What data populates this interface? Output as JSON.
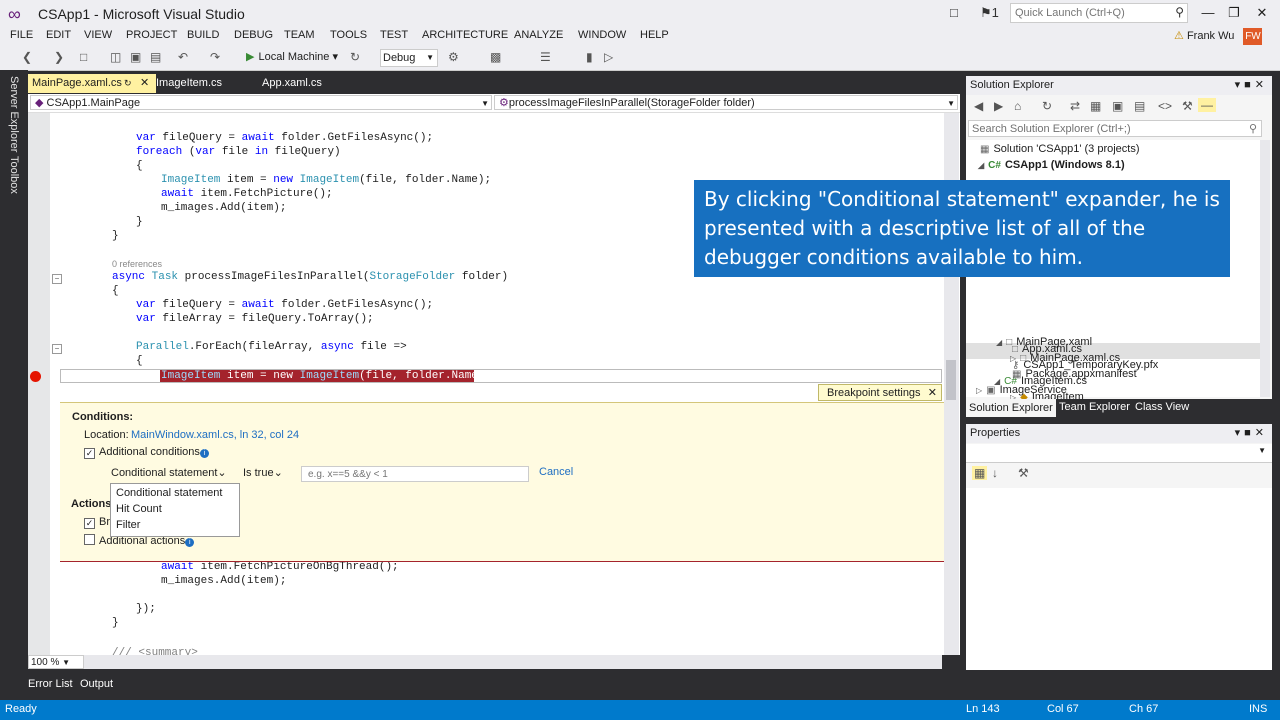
{
  "window": {
    "title": "CSApp1 - Microsoft Visual Studio",
    "quick_launch_placeholder": "Quick Launch (Ctrl+Q)",
    "notification_count": "1"
  },
  "menu": [
    "FILE",
    "EDIT",
    "VIEW",
    "PROJECT",
    "BUILD",
    "DEBUG",
    "TEAM",
    "TOOLS",
    "TEST",
    "ARCHITECTURE",
    "ANALYZE",
    "WINDOW",
    "HELP"
  ],
  "user": {
    "name": "Frank Wu",
    "initials": "FW"
  },
  "toolbar": {
    "target": "Local Machine",
    "configuration": "Debug"
  },
  "left_strip": [
    "Server Explorer",
    "Toolbox"
  ],
  "editor": {
    "tabs": [
      {
        "label": "MainPage.xaml.cs",
        "active": true
      },
      {
        "label": "ImageItem.cs",
        "active": false
      },
      {
        "label": "App.xaml.cs",
        "active": false
      }
    ],
    "nav_class": "CSApp1.MainPage",
    "nav_member": "processImageFilesInParallel(StorageFolder folder)",
    "references": "0 references",
    "zoom": "100 %"
  },
  "breakpoint_settings": {
    "tab_title": "Breakpoint settings",
    "conditions_heading": "Conditions:",
    "location_label": "Location:",
    "location_value": "MainWindow.xaml.cs, ln 32, col 24",
    "additional_conditions": "Additional conditions",
    "condition_type": "Conditional statement",
    "condition_op": "Is true",
    "condition_placeholder": "e.g. x==5 &&y < 1",
    "cancel": "Cancel",
    "actions_heading": "Actions",
    "break_label": "Br",
    "additional_actions": "Additional actions",
    "dropdown_options": [
      "Conditional statement",
      "Hit Count",
      "Filter"
    ]
  },
  "solution_explorer": {
    "title": "Solution Explorer",
    "search_placeholder": "Search Solution Explorer (Ctrl+;)",
    "tree": [
      "Solution 'CSApp1' (3 projects)",
      "CSApp1 (Windows 8.1)",
      "App.xaml.cs",
      "CSApp1_TemporaryKey.pfx",
      "ImageItem.cs",
      "ImageItem",
      "MainPage.xaml",
      "MainPage.xaml.cs",
      "Package.appxmanifest",
      "ImageService"
    ],
    "tabs": [
      "Solution Explorer",
      "Team Explorer",
      "Class View"
    ]
  },
  "properties": {
    "title": "Properties"
  },
  "bottom_tabs": [
    "Error List",
    "Output"
  ],
  "status": {
    "ready": "Ready",
    "ln": "Ln 143",
    "col": "Col 67",
    "ch": "Ch 67",
    "mode": "INS"
  },
  "callout": "By clicking \"Conditional statement\" expander, he is presented with a descriptive list of all of the debugger conditions available to him.",
  "colors": {
    "accent": "#007acc",
    "callout": "#1770c0",
    "breakpoint": "#e51400",
    "panel": "#fffbe1"
  }
}
